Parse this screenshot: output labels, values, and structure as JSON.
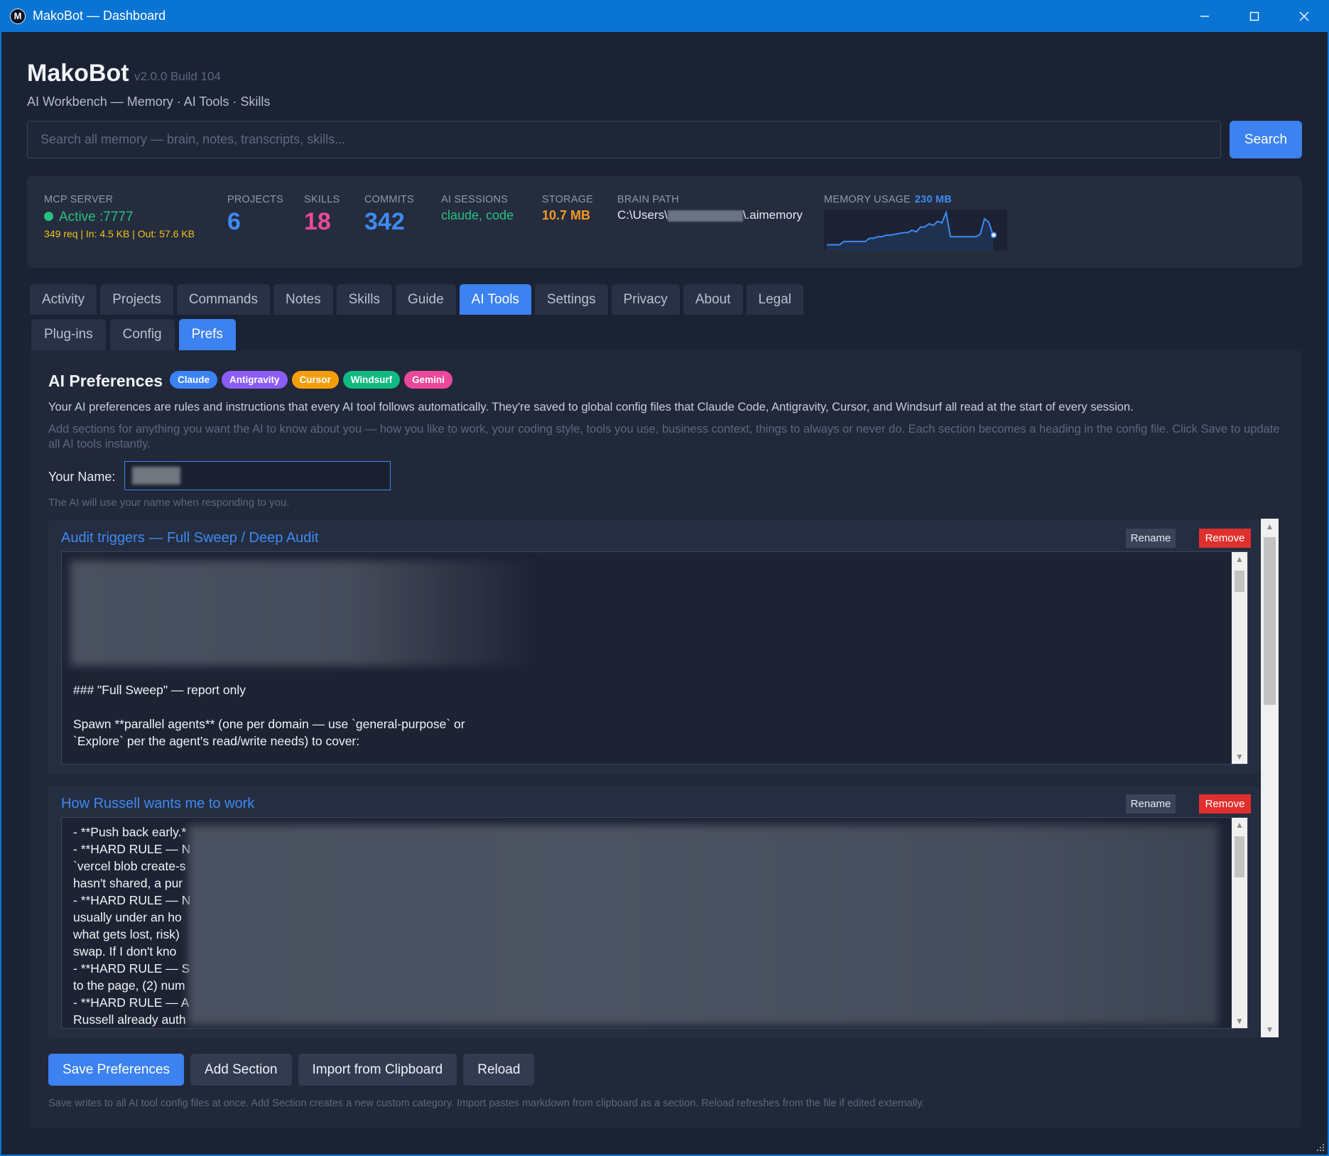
{
  "window": {
    "title": "MakoBot — Dashboard",
    "logo_letter": "M"
  },
  "header": {
    "app_name": "MakoBot",
    "version": "v2.0.0 Build 104",
    "subtitle": "AI Workbench — Memory · AI Tools · Skills"
  },
  "search": {
    "placeholder": "Search all memory — brain, notes, transcripts, skills...",
    "value": "",
    "button_label": "Search"
  },
  "stats": {
    "mcp": {
      "label": "MCP SERVER",
      "status": "Active :7777",
      "traffic": "349 req | In: 4.5 KB | Out: 57.6 KB",
      "status_color": "#27c281"
    },
    "projects": {
      "label": "PROJECTS",
      "value": "6",
      "color": "#3d8bf2"
    },
    "skills": {
      "label": "SKILLS",
      "value": "18",
      "color": "#ec4899"
    },
    "commits": {
      "label": "COMMITS",
      "value": "342",
      "color": "#3d8bf2"
    },
    "sessions": {
      "label": "AI SESSIONS",
      "value": "claude, code"
    },
    "storage": {
      "label": "STORAGE",
      "value": "10.7 MB"
    },
    "brain": {
      "label": "BRAIN PATH",
      "prefix": "C:\\Users\\",
      "suffix": "\\.aimemory"
    },
    "memory": {
      "label": "MEMORY USAGE",
      "value": "230 MB",
      "series": [
        40,
        40,
        40,
        40,
        36,
        36,
        36,
        36,
        36,
        36,
        32,
        32,
        30,
        30,
        28,
        28,
        27,
        26,
        25,
        25,
        22,
        24,
        18,
        18,
        14,
        16,
        11,
        13,
        0,
        30,
        30,
        30,
        30,
        30,
        30,
        30,
        27,
        8,
        12,
        28
      ]
    }
  },
  "tabs": [
    {
      "label": "Activity",
      "active": false
    },
    {
      "label": "Projects",
      "active": false
    },
    {
      "label": "Commands",
      "active": false
    },
    {
      "label": "Notes",
      "active": false
    },
    {
      "label": "Skills",
      "active": false
    },
    {
      "label": "Guide",
      "active": false
    },
    {
      "label": "AI Tools",
      "active": true
    },
    {
      "label": "Settings",
      "active": false
    },
    {
      "label": "Privacy",
      "active": false
    },
    {
      "label": "About",
      "active": false
    },
    {
      "label": "Legal",
      "active": false
    }
  ],
  "subtabs": [
    {
      "label": "Plug-ins",
      "active": false
    },
    {
      "label": "Config",
      "active": false
    },
    {
      "label": "Prefs",
      "active": true
    }
  ],
  "prefs": {
    "title": "AI Preferences",
    "badges": [
      {
        "label": "Claude",
        "color": "#3b82f6"
      },
      {
        "label": "Antigravity",
        "color": "#8b5cf6"
      },
      {
        "label": "Cursor",
        "color": "#f59e0b"
      },
      {
        "label": "Windsurf",
        "color": "#10b981"
      },
      {
        "label": "Gemini",
        "color": "#ec4899"
      }
    ],
    "intro": "Your AI preferences are rules and instructions that every AI tool follows automatically. They're saved to global config files that Claude Code, Antigravity, Cursor, and Windsurf all read at the start of every session.",
    "intro_detail": "Add sections for anything you want the AI to know about you — how you like to work, your coding style, tools you use, business context, things to always or never do. Each section becomes a heading in the config file. Click Save to update all AI tools instantly.",
    "name_label": "Your Name:",
    "name_value": "",
    "name_hint": "The AI will use your name when responding to you.",
    "sections": [
      {
        "title": "Audit triggers — Full Sweep / Deep Audit",
        "rename_label": "Rename",
        "remove_label": "Remove",
        "lines": [
          "### \"Full Sweep\" — report only",
          "",
          "Spawn **parallel agents** (one per domain — use `general-purpose` or",
          "`Explore` per the agent's read/write needs) to cover:"
        ]
      },
      {
        "title": "How Russell wants me to work",
        "rename_label": "Rename",
        "remove_label": "Remove",
        "lines": [
          "- **Push back early.*",
          "- **HARD RULE — N",
          "`vercel blob create-s",
          "hasn't shared, a pur",
          "- **HARD RULE — N",
          "usually under an ho",
          "what gets lost, risk)",
          "swap. If I don't kno",
          "- **HARD RULE — S",
          "to the page, (2) num",
          "- **HARD RULE — A",
          "Russell already auth"
        ]
      }
    ],
    "actions": {
      "save": "Save Preferences",
      "add": "Add Section",
      "import": "Import from Clipboard",
      "reload": "Reload"
    },
    "footer_hint": "Save writes to all AI tool config files at once. Add Section creates a new custom category. Import pastes markdown from clipboard as a section. Reload refreshes from the file if edited externally."
  }
}
